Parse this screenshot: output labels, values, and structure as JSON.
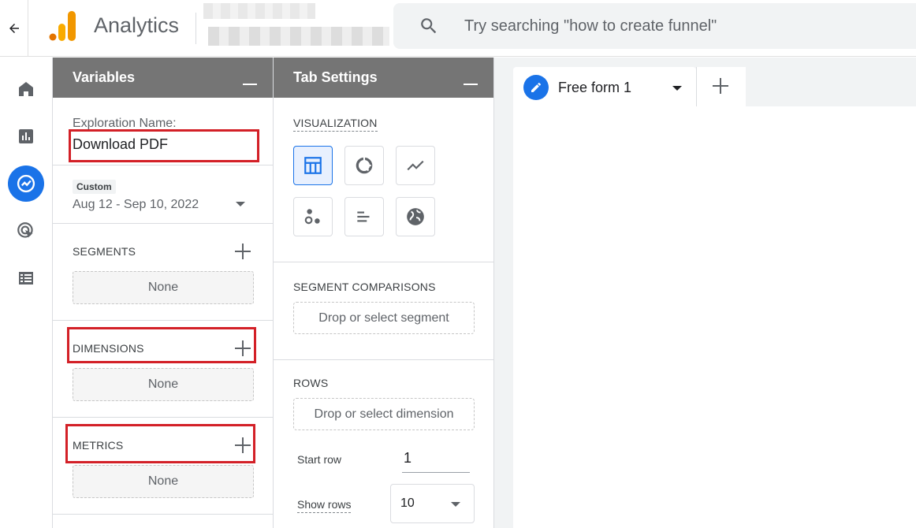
{
  "header": {
    "app_name": "Analytics",
    "search_placeholder": "Try searching \"how to create funnel\""
  },
  "rail": {
    "items": [
      "home-icon",
      "reports-icon",
      "explore-icon",
      "advertising-icon",
      "configure-icon"
    ],
    "active": "explore-icon"
  },
  "variables": {
    "title": "Variables",
    "exploration_label": "Exploration Name:",
    "exploration_name": "Download PDF",
    "date_badge": "Custom",
    "date_range": "Aug 12 - Sep 10, 2022",
    "segments_label": "SEGMENTS",
    "segments_value": "None",
    "dimensions_label": "DIMENSIONS",
    "dimensions_value": "None",
    "metrics_label": "METRICS",
    "metrics_value": "None"
  },
  "tab_settings": {
    "title": "Tab Settings",
    "visualization_label": "VISUALIZATION",
    "visualizations": [
      "table-icon",
      "donut-chart-icon",
      "line-chart-icon",
      "scatter-plot-icon",
      "bar-chart-icon",
      "geo-map-icon"
    ],
    "selected_visualization": "table-icon",
    "segment_comparisons_label": "SEGMENT COMPARISONS",
    "segment_drop": "Drop or select segment",
    "rows_label": "ROWS",
    "rows_drop": "Drop or select dimension",
    "start_row_label": "Start row",
    "start_row_value": "1",
    "show_rows_label": "Show rows",
    "show_rows_value": "10"
  },
  "canvas": {
    "tab_label": "Free form 1"
  },
  "colors": {
    "accent": "#1a73e8",
    "panel_header": "#757575",
    "highlight": "#d32027"
  }
}
